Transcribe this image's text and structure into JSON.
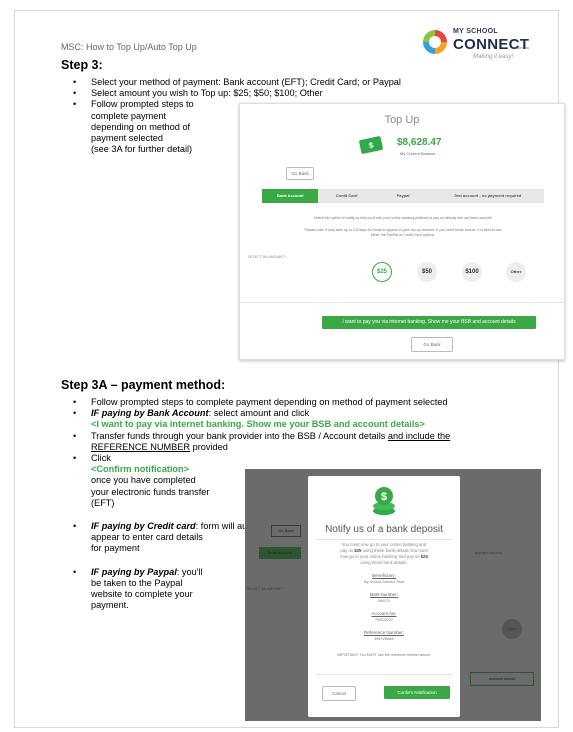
{
  "header": {
    "doc_title": "MSC: How to Top Up/Auto Top Up",
    "logo_line1": "MY SCHOOL",
    "logo_line2": "CONNECT",
    "logo_domain": ".com.au",
    "logo_tagline": "Making it easy!"
  },
  "step3": {
    "heading": "Step 3:",
    "bullet1": "Select your method of payment: Bank account (EFT); Credit Card; or Paypal",
    "bullet2": "Select amount you wish to Top up: $25; $50; $100; Other",
    "bullet3_lines": [
      "Follow prompted steps to",
      "complete payment",
      "depending on method of",
      "payment selected",
      "(see 3A for further detail)"
    ]
  },
  "topup_screen": {
    "title": "Top Up",
    "balance": "$8,628.47",
    "balance_label": "My Current Balance",
    "go_back": "Go Back",
    "tabs": [
      "Bank Account",
      "Credit Card",
      "Paypal",
      "Test account - no payment required"
    ],
    "info1": "Select this option to notify us that you'll use your online banking platform to pay us directly into our bank account.",
    "info2": "Please note, it may take up to 3-5 days for funds to appear in your top up account. If you need funds sooner, it is best to use either the PayPal or Credit Card options.",
    "select_label": "SELECT AN AMOUNT *",
    "amounts": [
      "$25",
      "$50",
      "$100",
      "Other"
    ],
    "action_button": "I want to pay you via internet banking. Show me your BSB and account details",
    "go_back_bottom": "Go Back"
  },
  "step3a": {
    "heading": "Step 3A – payment method:",
    "b1": "Follow prompted steps to complete payment depending on method of payment selected",
    "b2_prefix": "IF paying by Bank Account",
    "b2_suffix": ": select amount and click",
    "b2_green": "<I want to pay via internet banking. Show me your BSB and account details>",
    "b3_a": "Transfer funds through your bank provider into the BSB / Account details ",
    "b3_u1": "and include the",
    "b3_u2": "REFERENCE NUMBER",
    "b3_b": " provided",
    "b4_click": "Click",
    "b4_green": "<Confirm notification>",
    "b4_rest": [
      "once you have completed",
      "your electronic funds transfer",
      "(EFT)"
    ],
    "b5_prefix": "IF paying by Credit card",
    "b5_rest": [
      ": form will automatically",
      "appear to enter card details",
      "for payment"
    ],
    "b6_prefix": "IF paying by Paypal",
    "b6_rest": [
      ": you'll",
      "be taken to the Paypal",
      "website to complete your",
      "payment."
    ]
  },
  "notify_modal": {
    "title": "Notify us of a bank deposit",
    "text_line1": "You must now go to your online banking and",
    "text_line2a": "pay us ",
    "amt": "$25",
    "text_line2b": " using these bank details.You must",
    "text_line3a": "now go to your online banking and pay us ",
    "text_line4": "using these bank details.",
    "beneficiary_label": "Beneficiary:",
    "beneficiary": "My School Connect Trust",
    "bsb_label": "BSB Number:",
    "bsb": "084170",
    "account_label": "Account No:",
    "account": "794576222",
    "ref_label": "Reference Number:",
    "ref": "4957VBA8A",
    "important": "IMPORTANT: You MUST use the reference number above.",
    "cancel": "Cancel",
    "confirm": "Confirm Notification",
    "bg_go_back": "Go Back",
    "bg_tab": "Bank Account",
    "bg_required": "payment required",
    "bg_select": "SELECT AN AMOUNT *",
    "bg_other": "Other",
    "bg_account_details": "account details"
  }
}
